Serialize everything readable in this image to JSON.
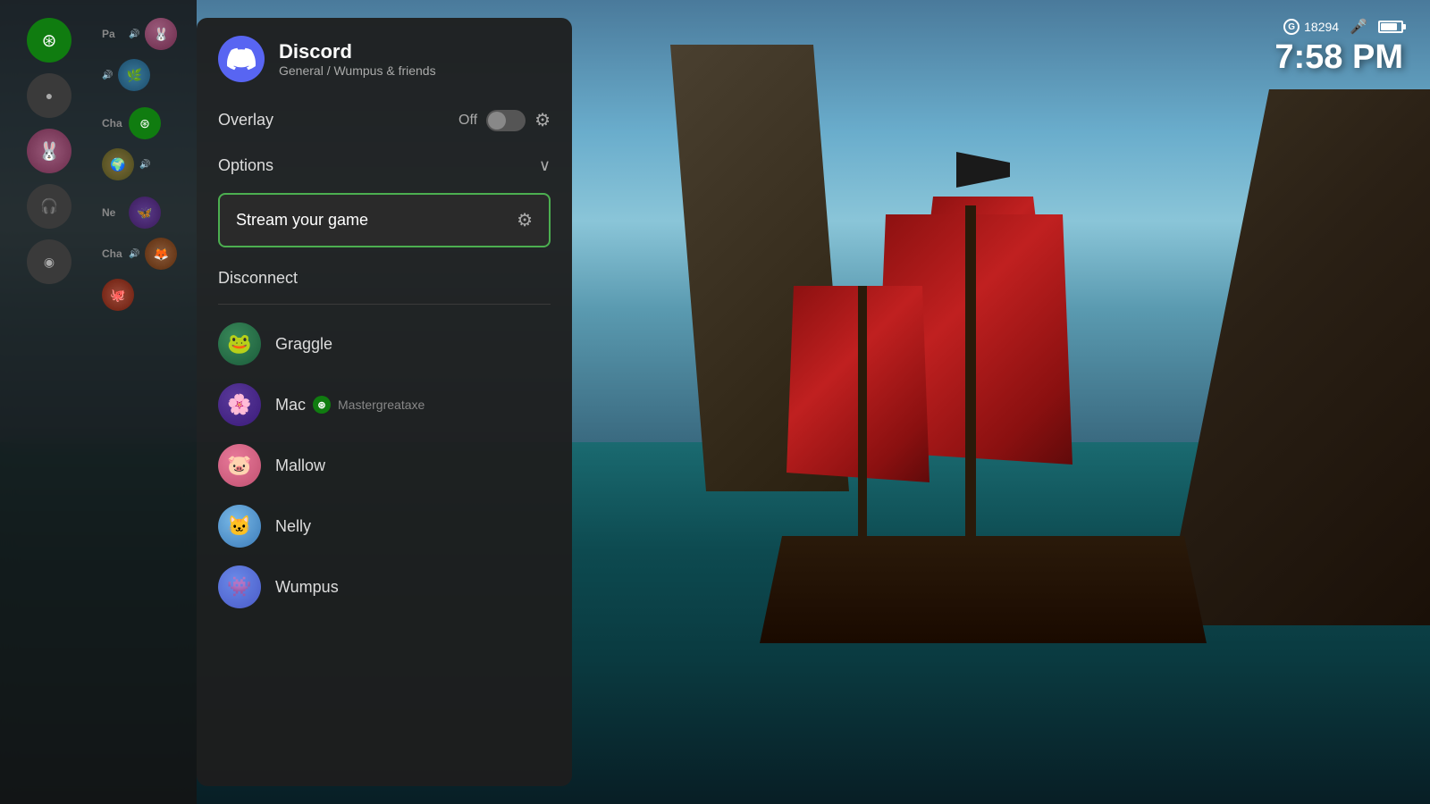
{
  "background": {
    "scene": "pirate ship sea of thieves"
  },
  "status_bar": {
    "g_score": "18294",
    "time": "7:58 PM"
  },
  "discord": {
    "logo_alt": "Discord logo",
    "app_name": "Discord",
    "subtitle": "General / Wumpus & friends",
    "overlay_label": "Overlay",
    "overlay_state": "Off",
    "options_label": "Options",
    "stream_label": "Stream your game",
    "disconnect_label": "Disconnect",
    "users": [
      {
        "id": "graggle",
        "name": "Graggle",
        "avatar_class": "av-graggle",
        "emoji": "🐸",
        "xbox": false,
        "gamertag": ""
      },
      {
        "id": "mac",
        "name": "Mac",
        "avatar_class": "av-mac",
        "emoji": "🌸",
        "xbox": true,
        "gamertag": "Mastergreataxe"
      },
      {
        "id": "mallow",
        "name": "Mallow",
        "avatar_class": "av-mallow",
        "emoji": "🐷",
        "xbox": false,
        "gamertag": ""
      },
      {
        "id": "nelly",
        "name": "Nelly",
        "avatar_class": "av-nelly",
        "emoji": "🐱",
        "xbox": false,
        "gamertag": ""
      },
      {
        "id": "wumpus",
        "name": "Wumpus",
        "avatar_class": "av-wumpus",
        "emoji": "👾",
        "xbox": false,
        "gamertag": ""
      }
    ]
  },
  "sidebar": {
    "labels": [
      "Pa",
      "Cha",
      "Ne",
      "Cha"
    ]
  }
}
